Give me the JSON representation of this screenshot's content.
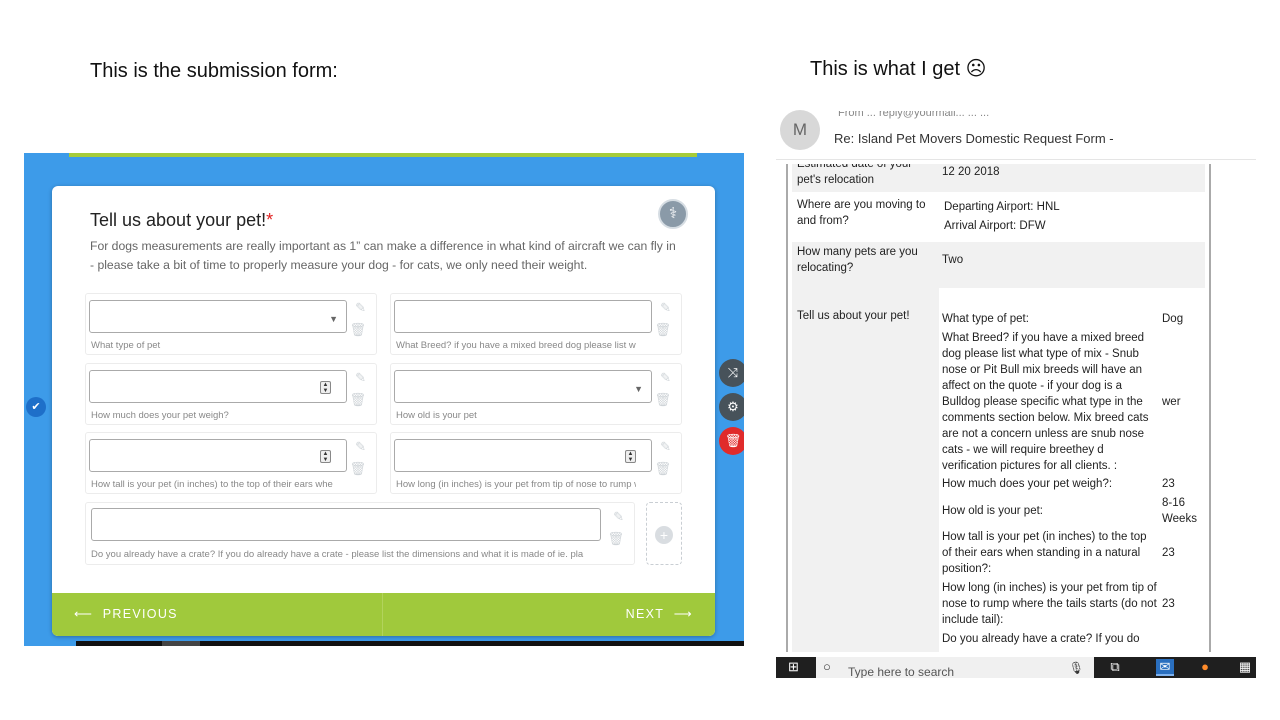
{
  "captions": {
    "left": "This is the submission form:",
    "right": "This is what I get ☹"
  },
  "form": {
    "title": "Tell us about your pet!",
    "required_mark": "*",
    "description": "For dogs measurements are really important as 1” can make a difference in what kind of aircraft we can fly in - please take a bit of time to properly measure your dog - for cats, we only need their weight.",
    "fields": [
      {
        "label": "What type of pet"
      },
      {
        "label": "What Breed? if you have a mixed breed dog please list wha"
      },
      {
        "label": "How much does your pet weigh?"
      },
      {
        "label": "How old is your pet"
      },
      {
        "label": "How tall is your pet (in inches) to the top of their ears wher"
      },
      {
        "label": "How long (in inches) is your pet from tip of nose to rump w"
      },
      {
        "label": "Do you already have a crate? If you do already have a crate - please list the dimensions and what it is made of ie. pla"
      }
    ],
    "prev_label": "PREVIOUS",
    "next_label": "NEXT",
    "colors": {
      "nav": "#a0c93c",
      "background": "#3d9be9",
      "required": "#e02020"
    }
  },
  "email": {
    "avatar_initial": "M",
    "from_line": "From  ...  reply@yourmail...   ...   ...",
    "subject": "Re: Island Pet Movers Domestic Request Form -",
    "rows": [
      {
        "question": "Estimated date of your pet's relocation",
        "answer": "12 20 2018"
      },
      {
        "question": "Where are you moving to and from?",
        "answer_lines": [
          "Departing Airport: HNL",
          "Arrival Airport:       DFW"
        ]
      },
      {
        "question": "How many pets are you relocating?",
        "answer": "Two"
      },
      {
        "question": "Tell us about your pet!",
        "sub": [
          {
            "q": "What type of pet:",
            "a": "Dog"
          },
          {
            "q": "What Breed? if you have a mixed breed dog please list what type of mix - Snub nose or Pit Bull mix breeds will have an affect on the quote - if your dog is a Bulldog please specific what type in the comments section below. Mix breed cats are not a concern unless are snub nose cats - we will require breethey d verification pictures for all clients. :",
            "a": "wer"
          },
          {
            "q": "How much does your pet weigh?:",
            "a": "23"
          },
          {
            "q": "How old is your pet:",
            "a": "8-16 Weeks"
          },
          {
            "q": "How tall is your pet (in inches) to the top of their ears when standing in a natural position?:",
            "a": "23"
          },
          {
            "q": "How long (in inches) is your pet from tip of nose to rump where the tails starts (do not include tail):",
            "a": "23"
          },
          {
            "q": "Do you already have a crate? If you do",
            "a": ""
          }
        ]
      }
    ]
  },
  "taskbar": {
    "search_placeholder": "Type here to search"
  }
}
